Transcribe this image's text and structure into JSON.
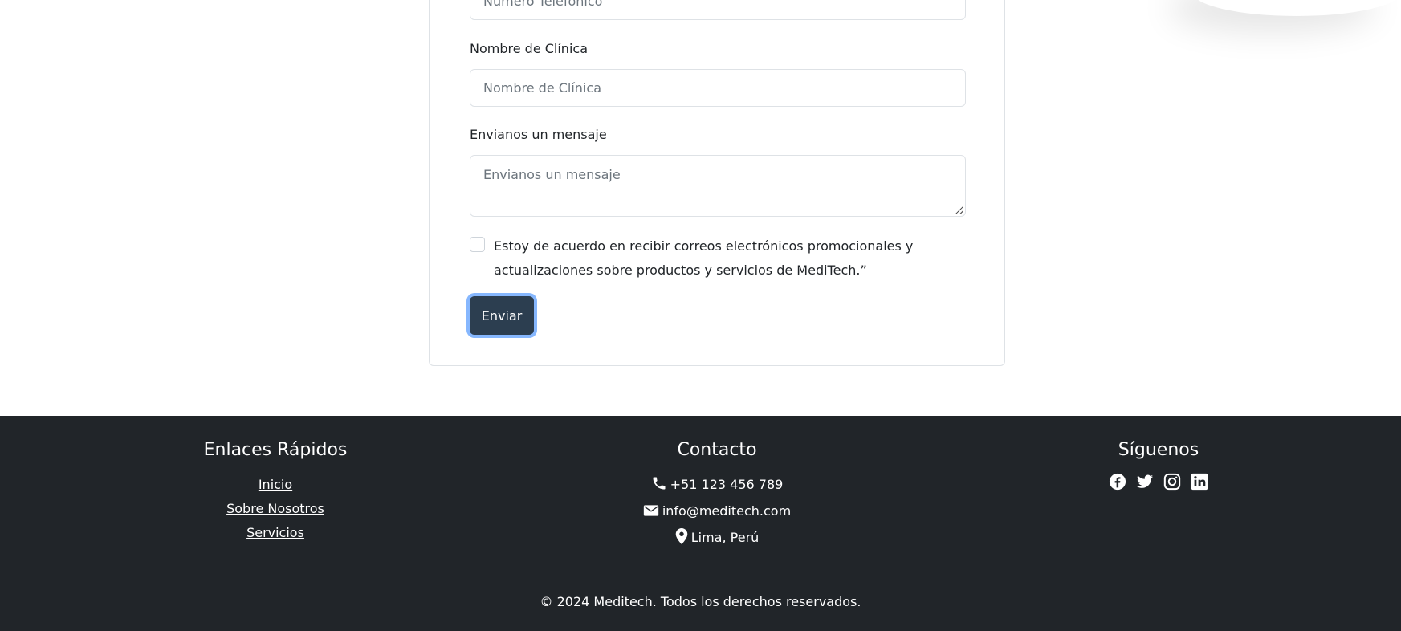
{
  "form": {
    "phone_placeholder": "Número Telefónico",
    "clinic_label": "Nombre de Clínica",
    "clinic_placeholder": "Nombre de Clínica",
    "message_label": "Envianos un mensaje",
    "message_placeholder": "Envianos un mensaje",
    "consent_text": "Estoy de acuerdo en recibir correos electrónicos promocionales y actualizaciones sobre productos y servicios de MediTech.”",
    "submit_label": "Enviar"
  },
  "footer": {
    "quick_links": {
      "title": "Enlaces Rápidos",
      "links": [
        "Inicio",
        "Sobre Nosotros",
        "Servicios"
      ]
    },
    "contact": {
      "title": "Contacto",
      "phone": "+51 123 456 789",
      "email": "info@meditech.com",
      "location": "Lima, Perú"
    },
    "social": {
      "title": "Síguenos",
      "icons": [
        "facebook-icon",
        "twitter-icon",
        "instagram-icon",
        "linkedin-icon"
      ]
    },
    "copyright": "© 2024 Meditech. Todos los derechos reservados."
  },
  "colors": {
    "button_bg": "#2c3e50",
    "footer_bg": "#212529",
    "focus_ring": "#86b7fe"
  }
}
